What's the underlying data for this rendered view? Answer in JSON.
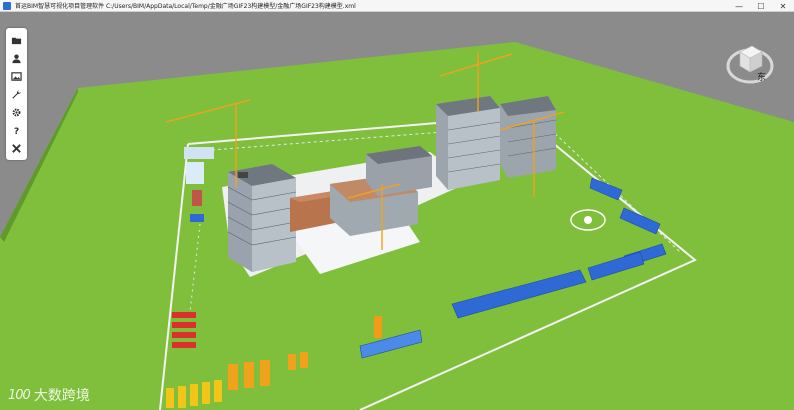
{
  "window": {
    "title": "首运BIM智慧可视化项目管理软件    C:/Users/BIM/AppData/Local/Temp/金融广场GIF23构建模型/金融广场GIF23构建模型.xml",
    "minimize_symbol": "—",
    "maximize_symbol": "☐",
    "close_symbol": "✕",
    "collapse_symbol": "▾"
  },
  "toolbar": {
    "items": [
      {
        "icon": "folder-icon"
      },
      {
        "icon": "person-icon"
      },
      {
        "icon": "image-icon"
      },
      {
        "icon": "wrench-icon"
      },
      {
        "icon": "gear-icon"
      },
      {
        "icon": "help-icon",
        "label": "?"
      },
      {
        "icon": "close-icon",
        "label": "✕"
      }
    ]
  },
  "viewcube": {
    "face_label": "东"
  },
  "watermark": {
    "logo": "100",
    "text": "大数跨境"
  },
  "colors": {
    "ground": "#7fbf3a",
    "sky": "#8a8a8a",
    "road": "#e8ecef",
    "sheds": "#2f69d6",
    "crane": "#f2a21b"
  }
}
